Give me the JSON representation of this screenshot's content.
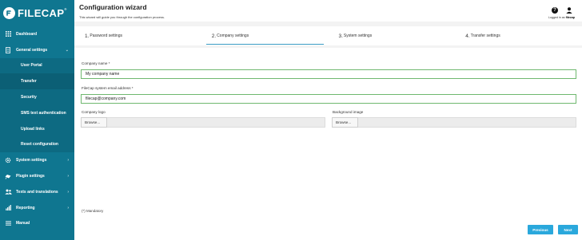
{
  "brand": {
    "name": "FILECAP",
    "mark": "®"
  },
  "sidebar": {
    "items": [
      {
        "label": "Dashboard",
        "icon": "grid-icon"
      },
      {
        "label": "General settings",
        "icon": "document-icon"
      },
      {
        "label": "User Portal"
      },
      {
        "label": "Transfer"
      },
      {
        "label": "Security"
      },
      {
        "label": "SMS text authentication"
      },
      {
        "label": "Upload links"
      },
      {
        "label": "Reset configuration"
      },
      {
        "label": "System settings",
        "icon": "gear-icon"
      },
      {
        "label": "Plugin settings",
        "icon": "plugin-icon"
      },
      {
        "label": "Texts and translations",
        "icon": "users-icon"
      },
      {
        "label": "Reporting",
        "icon": "bar-chart-icon"
      },
      {
        "label": "Manual",
        "icon": "menu-icon"
      }
    ]
  },
  "header": {
    "title": "Configuration wizard",
    "subtitle": "This wizard will guide you through the configuration process.",
    "logged_prefix": "Logged in as",
    "username": "filecap"
  },
  "steps": [
    {
      "num": "1.",
      "label": "Password settings"
    },
    {
      "num": "2.",
      "label": "Company settings"
    },
    {
      "num": "3.",
      "label": "System settings"
    },
    {
      "num": "4.",
      "label": "Transfer settings"
    }
  ],
  "form": {
    "company_name_label": "Company name *",
    "company_name_value": "My company name",
    "email_label": "FileCap system email address *",
    "email_value": "filecap@company.com",
    "logo_label": "Company logo",
    "background_label": "Background image",
    "browse_label": "Browse...",
    "mandatory_note": "(*) Mandatory"
  },
  "footer": {
    "previous_label": "Previous",
    "next_label": "Next"
  },
  "colors": {
    "sidebar": "#0f7690",
    "accent": "#2aa8dc",
    "input_border": "#6fb86f"
  }
}
